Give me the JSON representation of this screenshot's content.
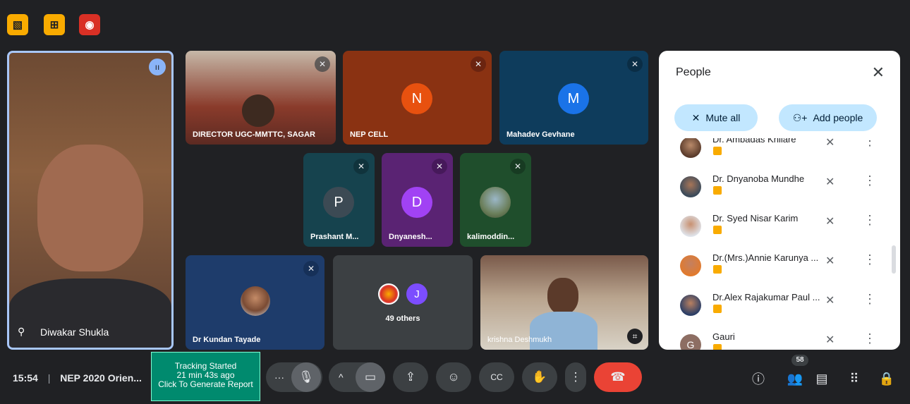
{
  "extensions": [
    {
      "icon": "extension-icon-1"
    },
    {
      "icon": "extension-icon-2"
    },
    {
      "icon": "record-icon"
    }
  ],
  "speaker": {
    "name": "Diwakar Shukla",
    "pin_icon": "pin-icon",
    "speaking_icon": "speaking-icon"
  },
  "tiles": {
    "director": {
      "name": "DIRECTOR UGC-MMTTC, SAGAR"
    },
    "nep_cell": {
      "name": "NEP CELL",
      "initial": "N",
      "color": "#e8510f",
      "bg": "#8a3212"
    },
    "mahadev": {
      "name": "Mahadev Gevhane",
      "initial": "M",
      "color": "#1a73e8",
      "bg": "#0e3c5c"
    },
    "prashant": {
      "name": "Prashant M...",
      "initial": "P",
      "color": "#3c4a54",
      "bg": "#16434e"
    },
    "dnyanesh": {
      "name": "Dnyanesh...",
      "initial": "D",
      "color": "#a142f4",
      "bg": "#5a2373"
    },
    "kalimoddin": {
      "name": "kalimoddin...",
      "bg": "#1f4e2c"
    },
    "kundan": {
      "name": "Dr Kundan Tayade",
      "bg": "#1e3c6b"
    },
    "others": {
      "label": "49 others",
      "initial": "J",
      "color": "#7c4dff"
    },
    "krishna": {
      "name": "krishna Deshmukh"
    }
  },
  "people_panel": {
    "title": "People",
    "mute_all": "Mute all",
    "add_people": "Add people",
    "people": [
      {
        "name": "Dr. Ambadas Khilare"
      },
      {
        "name": "Dr. Dnyanoba Mundhe"
      },
      {
        "name": "Dr. Syed Nisar Karim"
      },
      {
        "name": "Dr.(Mrs.)Annie Karunya ..."
      },
      {
        "name": "Dr.Alex Rajakumar Paul ..."
      },
      {
        "name": "Gauri",
        "initial": "G"
      }
    ]
  },
  "meeting": {
    "time": "15:54",
    "separator": "|",
    "title": "NEP 2020 Orien..."
  },
  "tracker": {
    "line1": "Tracking Started",
    "line2": "21 min 43s ago",
    "line3": "Click To Generate Report"
  },
  "controls": {
    "more_dots": "···",
    "up": "^",
    "people_count": "58"
  },
  "colors": {
    "hangup": "#ea4335",
    "accent": "#8ab4f8",
    "pill": "#c2e7ff"
  }
}
